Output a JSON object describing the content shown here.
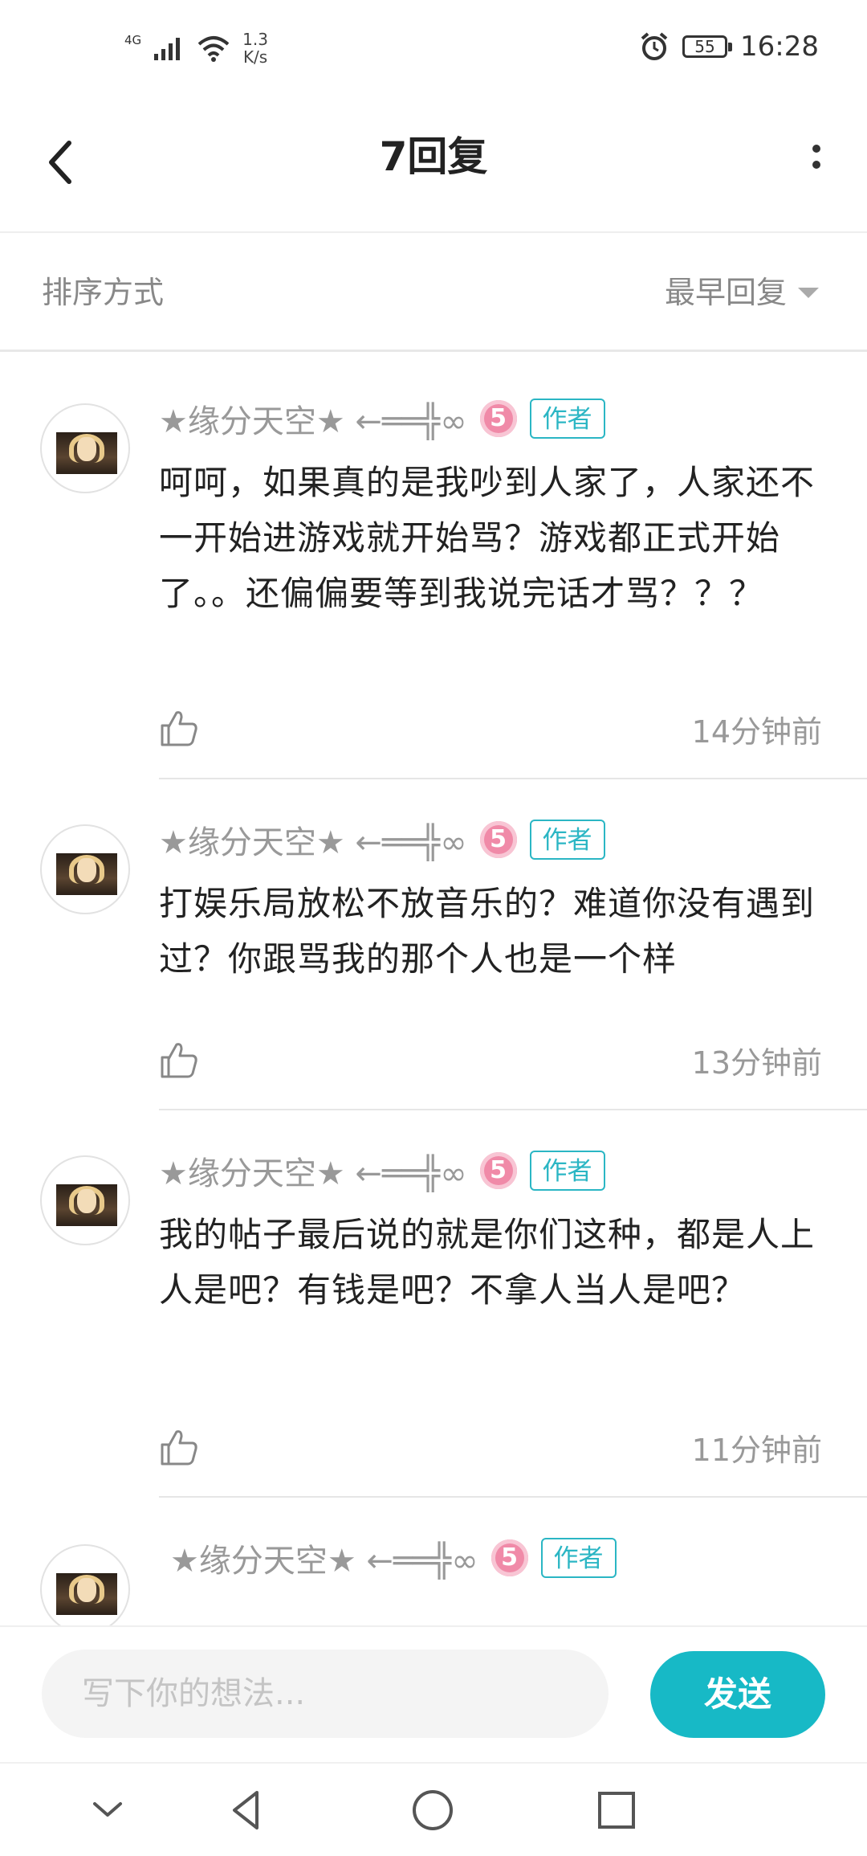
{
  "status_bar": {
    "network": "4G",
    "speed_value": "1.3",
    "speed_unit": "K/s",
    "battery": "55",
    "time": "16:28"
  },
  "header": {
    "title": "7回复"
  },
  "sort": {
    "label": "排序方式",
    "value": "最早回复"
  },
  "replies": [
    {
      "username": "★缘分天空★ ←══╬∞",
      "level": "5",
      "tag": "作者",
      "text": "呵呵，如果真的是我吵到人家了，人家还不一开始进游戏就开始骂？游戏都正式开始了。。还偏偏要等到我说完话才骂？？？",
      "time": "14分钟前"
    },
    {
      "username": "★缘分天空★ ←══╬∞",
      "level": "5",
      "tag": "作者",
      "text": "打娱乐局放松不放音乐的？难道你没有遇到过？你跟骂我的那个人也是一个样",
      "time": "13分钟前"
    },
    {
      "username": "★缘分天空★ ←══╬∞",
      "level": "5",
      "tag": "作者",
      "text": "我的帖子最后说的就是你们这种，都是人上人是吧？有钱是吧？不拿人当人是吧？",
      "time": "11分钟前"
    },
    {
      "username": "★缘分天空★ ←══╬∞",
      "level": "5",
      "tag": "作者"
    }
  ],
  "composer": {
    "placeholder": "写下你的想法...",
    "send_label": "发送"
  },
  "colors": {
    "accent": "#17b9c6",
    "author_tag": "#2bb6c4",
    "level_badge": "#f08aa8",
    "muted_text": "#999999"
  }
}
